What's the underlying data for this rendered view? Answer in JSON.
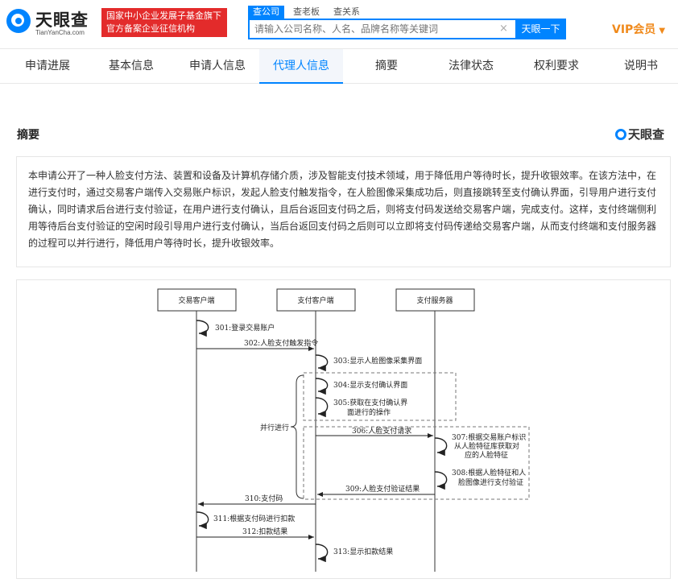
{
  "header": {
    "logo_text": "天眼查",
    "logo_sub": "TianYanCha.com",
    "banner_line1": "国家中小企业发展子基金旗下",
    "banner_line2": "官方备案企业征信机构",
    "search_tabs": [
      "查公司",
      "查老板",
      "查关系"
    ],
    "search_placeholder": "请输入公司名称、人名、品牌名称等关键词",
    "search_clear": "×",
    "search_button": "天眼一下",
    "vip_label": "VIP会员",
    "vip_caret": "▼"
  },
  "nav": {
    "tabs": [
      "申请进展",
      "基本信息",
      "申请人信息",
      "代理人信息",
      "摘要",
      "法律状态",
      "权利要求",
      "说明书"
    ],
    "active_index": 3
  },
  "abstract": {
    "title": "摘要",
    "watermark": "天眼查",
    "text": "本申请公开了一种人脸支付方法、装置和设备及计算机存储介质，涉及智能支付技术领域，用于降低用户等待时长，提升收银效率。在该方法中，在进行支付时，通过交易客户端传入交易账户标识，发起人脸支付触发指令，在人脸图像采集成功后，则直接跳转至支付确认界面，引导用户进行支付确认，同时请求后台进行支付验证，在用户进行支付确认，且后台返回支付码之后，则将支付码发送给交易客户端，完成支付。这样，支付终端侧利用等待后台支付验证的空闲时段引导用户进行支付确认，当后台返回支付码之后则可以立即将支付码传递给交易客户端，从而支付终端和支付服务器的过程可以并行进行，降低用户等待时长，提升收银效率。"
  },
  "diagram": {
    "lanes": [
      "交易客户端",
      "支付客户端",
      "支付服务器"
    ],
    "parallel_label": "并行进行",
    "steps": {
      "s301": "301:登录交易账户",
      "s302": "302:人脸支付触发指令",
      "s303": "303:显示人脸图像采集界面",
      "s304": "304:显示支付确认界面",
      "s305a": "305:获取在支付确认界",
      "s305b": "面进行的操作",
      "s306": "306:人脸支付请求",
      "s307a": "307:根据交易账户标识",
      "s307b": "从人脸特征库获取对",
      "s307c": "应的人脸特征",
      "s308a": "308:根据人脸特征和人",
      "s308b": "脸图像进行支付验证",
      "s309": "309:人脸支付验证结果",
      "s310": "310:支付码",
      "s311": "311:根据支付码进行扣款",
      "s312": "312:扣款结果",
      "s313": "313:显示扣款结果"
    }
  }
}
